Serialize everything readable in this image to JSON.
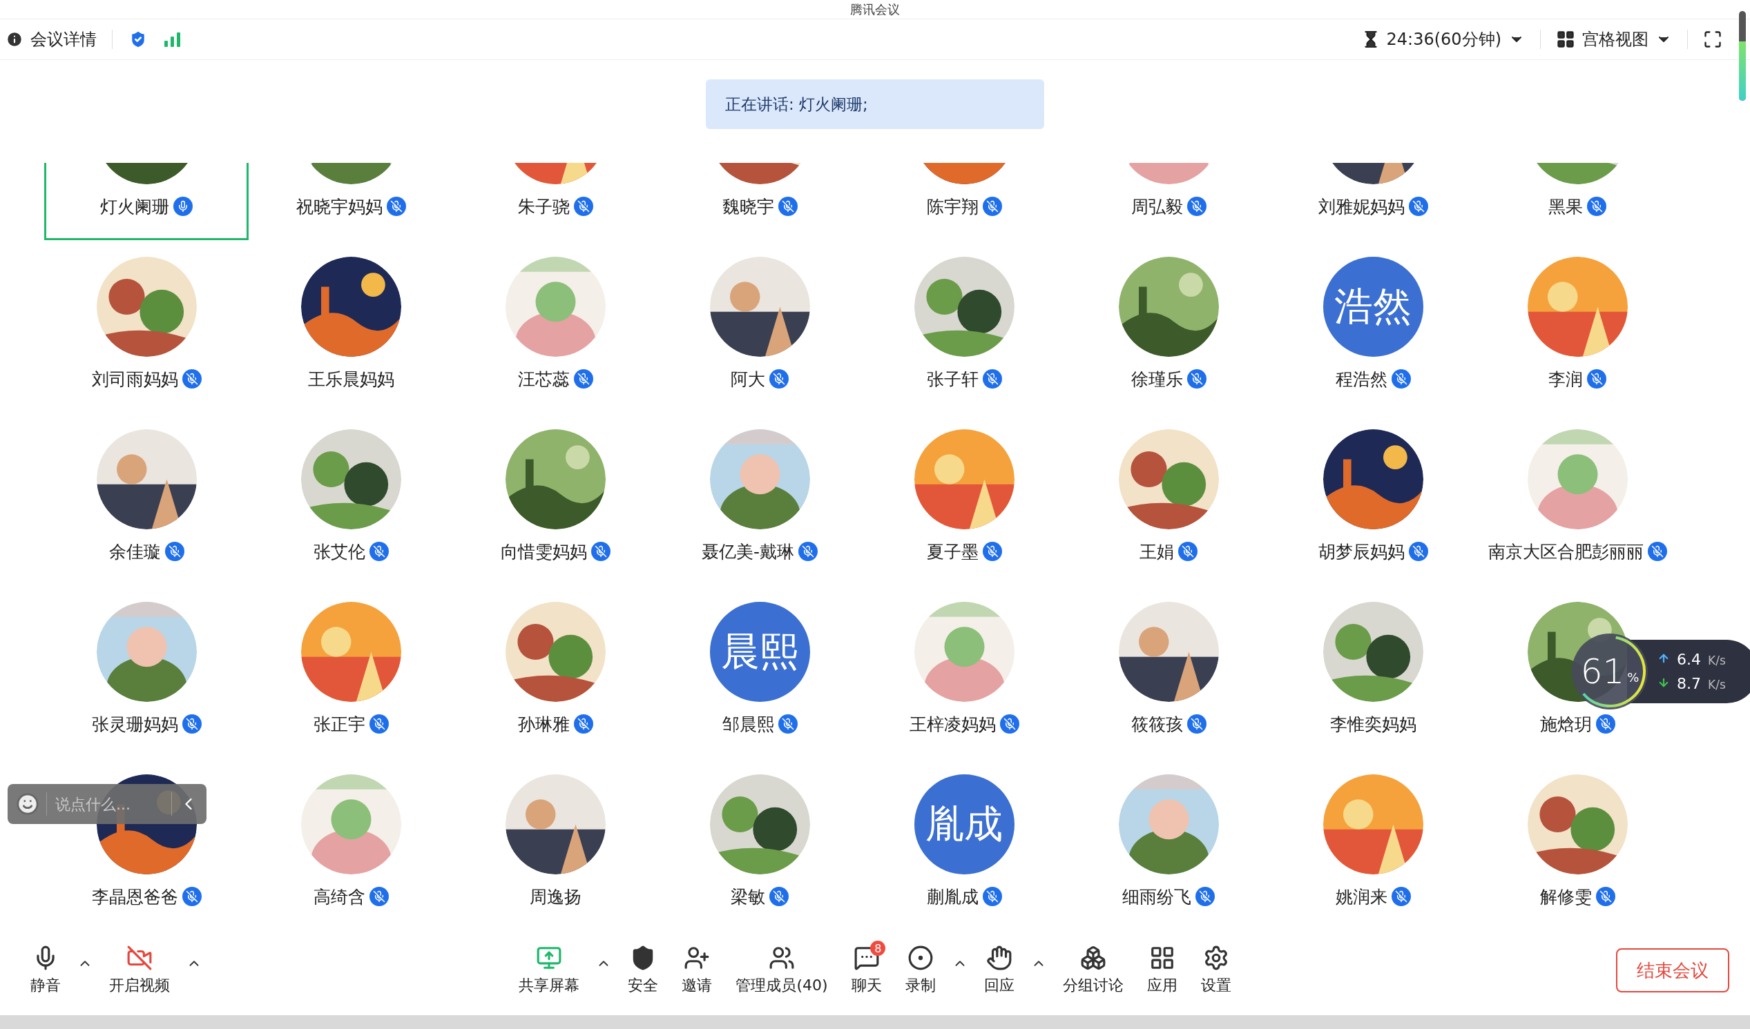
{
  "window": {
    "title": "腾讯会议"
  },
  "top_bar": {
    "details": "会议详情",
    "timer": "24:36(60分钟)",
    "view": "宫格视图"
  },
  "speaking_banner": "正在讲话: 灯火阑珊;",
  "participants": [
    {
      "name": "灯火阑珊",
      "speaking": true,
      "mic": true
    },
    {
      "name": "祝晓宇妈妈",
      "speaking": false,
      "mic": true
    },
    {
      "name": "朱子骁",
      "speaking": false,
      "mic": true
    },
    {
      "name": "魏晓宇",
      "speaking": false,
      "mic": true
    },
    {
      "name": "陈宇翔",
      "speaking": false,
      "mic": true
    },
    {
      "name": "周弘毅",
      "speaking": false,
      "mic": true
    },
    {
      "name": "刘雅妮妈妈",
      "speaking": false,
      "mic": true
    },
    {
      "name": "黑果",
      "speaking": false,
      "mic": true
    },
    {
      "name": "刘司雨妈妈",
      "speaking": false,
      "mic": true
    },
    {
      "name": "王乐晨妈妈",
      "speaking": false,
      "mic": false
    },
    {
      "name": "汪芯蕊",
      "speaking": false,
      "mic": true
    },
    {
      "name": "阿大",
      "speaking": false,
      "mic": true
    },
    {
      "name": "张子轩",
      "speaking": false,
      "mic": true
    },
    {
      "name": "徐瑾乐",
      "speaking": false,
      "mic": true
    },
    {
      "name": "程浩然",
      "speaking": false,
      "mic": true,
      "avatar": {
        "kind": "text",
        "text": "浩然"
      }
    },
    {
      "name": "李润",
      "speaking": false,
      "mic": true
    },
    {
      "name": "余佳璇",
      "speaking": false,
      "mic": true
    },
    {
      "name": "张艾伦",
      "speaking": false,
      "mic": true
    },
    {
      "name": "向惜雯妈妈",
      "speaking": false,
      "mic": true
    },
    {
      "name": "聂亿美-戴琳",
      "speaking": false,
      "mic": true
    },
    {
      "name": "夏子墨",
      "speaking": false,
      "mic": true
    },
    {
      "name": "王娟",
      "speaking": false,
      "mic": true
    },
    {
      "name": "胡梦辰妈妈",
      "speaking": false,
      "mic": true
    },
    {
      "name": "南京大区合肥彭丽丽",
      "speaking": false,
      "mic": true
    },
    {
      "name": "张灵珊妈妈",
      "speaking": false,
      "mic": true
    },
    {
      "name": "张正宇",
      "speaking": false,
      "mic": true
    },
    {
      "name": "孙琳雅",
      "speaking": false,
      "mic": true
    },
    {
      "name": "邹晨熙",
      "speaking": false,
      "mic": true,
      "avatar": {
        "kind": "text",
        "text": "晨熙"
      }
    },
    {
      "name": "王梓凌妈妈",
      "speaking": false,
      "mic": true
    },
    {
      "name": "筱筱孩",
      "speaking": false,
      "mic": true
    },
    {
      "name": "李惟奕妈妈",
      "speaking": false,
      "mic": false
    },
    {
      "name": "施焓玥",
      "speaking": false,
      "mic": true
    },
    {
      "name": "李晶恩爸爸",
      "speaking": false,
      "mic": true
    },
    {
      "name": "高绮含",
      "speaking": false,
      "mic": true
    },
    {
      "name": "周逸扬",
      "speaking": false,
      "mic": false
    },
    {
      "name": "梁敏",
      "speaking": false,
      "mic": true
    },
    {
      "name": "蒯胤成",
      "speaking": false,
      "mic": true,
      "avatar": {
        "kind": "text",
        "text": "胤成"
      }
    },
    {
      "name": "细雨纷飞",
      "speaking": false,
      "mic": true
    },
    {
      "name": "姚润来",
      "speaking": false,
      "mic": true
    },
    {
      "name": "解修雯",
      "speaking": false,
      "mic": true
    }
  ],
  "chat_input": {
    "placeholder": "说点什么..."
  },
  "network": {
    "percent": "61",
    "unit": "%",
    "level": 0.61,
    "upload": "6.4",
    "upload_unit": "K/s",
    "download": "8.7",
    "download_unit": "K/s"
  },
  "toolbar": {
    "left": [
      {
        "label": "静音",
        "kind": "mic",
        "menu": true
      },
      {
        "label": "开启视频",
        "kind": "video-off",
        "menu": true
      }
    ],
    "center": [
      {
        "label": "共享屏幕",
        "kind": "share",
        "menu": true
      },
      {
        "label": "安全",
        "kind": "shield",
        "menu": false
      },
      {
        "label": "邀请",
        "kind": "invite",
        "menu": false
      },
      {
        "label": "管理成员(40)",
        "kind": "members",
        "menu": false
      },
      {
        "label": "聊天",
        "kind": "chat",
        "menu": false,
        "badge": "8"
      },
      {
        "label": "录制",
        "kind": "record",
        "menu": true
      },
      {
        "label": "回应",
        "kind": "react",
        "menu": true
      },
      {
        "label": "分组讨论",
        "kind": "groups",
        "menu": false
      },
      {
        "label": "应用",
        "kind": "apps",
        "menu": false
      },
      {
        "label": "设置",
        "kind": "settings",
        "menu": false
      }
    ],
    "end_button": "结束会议"
  }
}
